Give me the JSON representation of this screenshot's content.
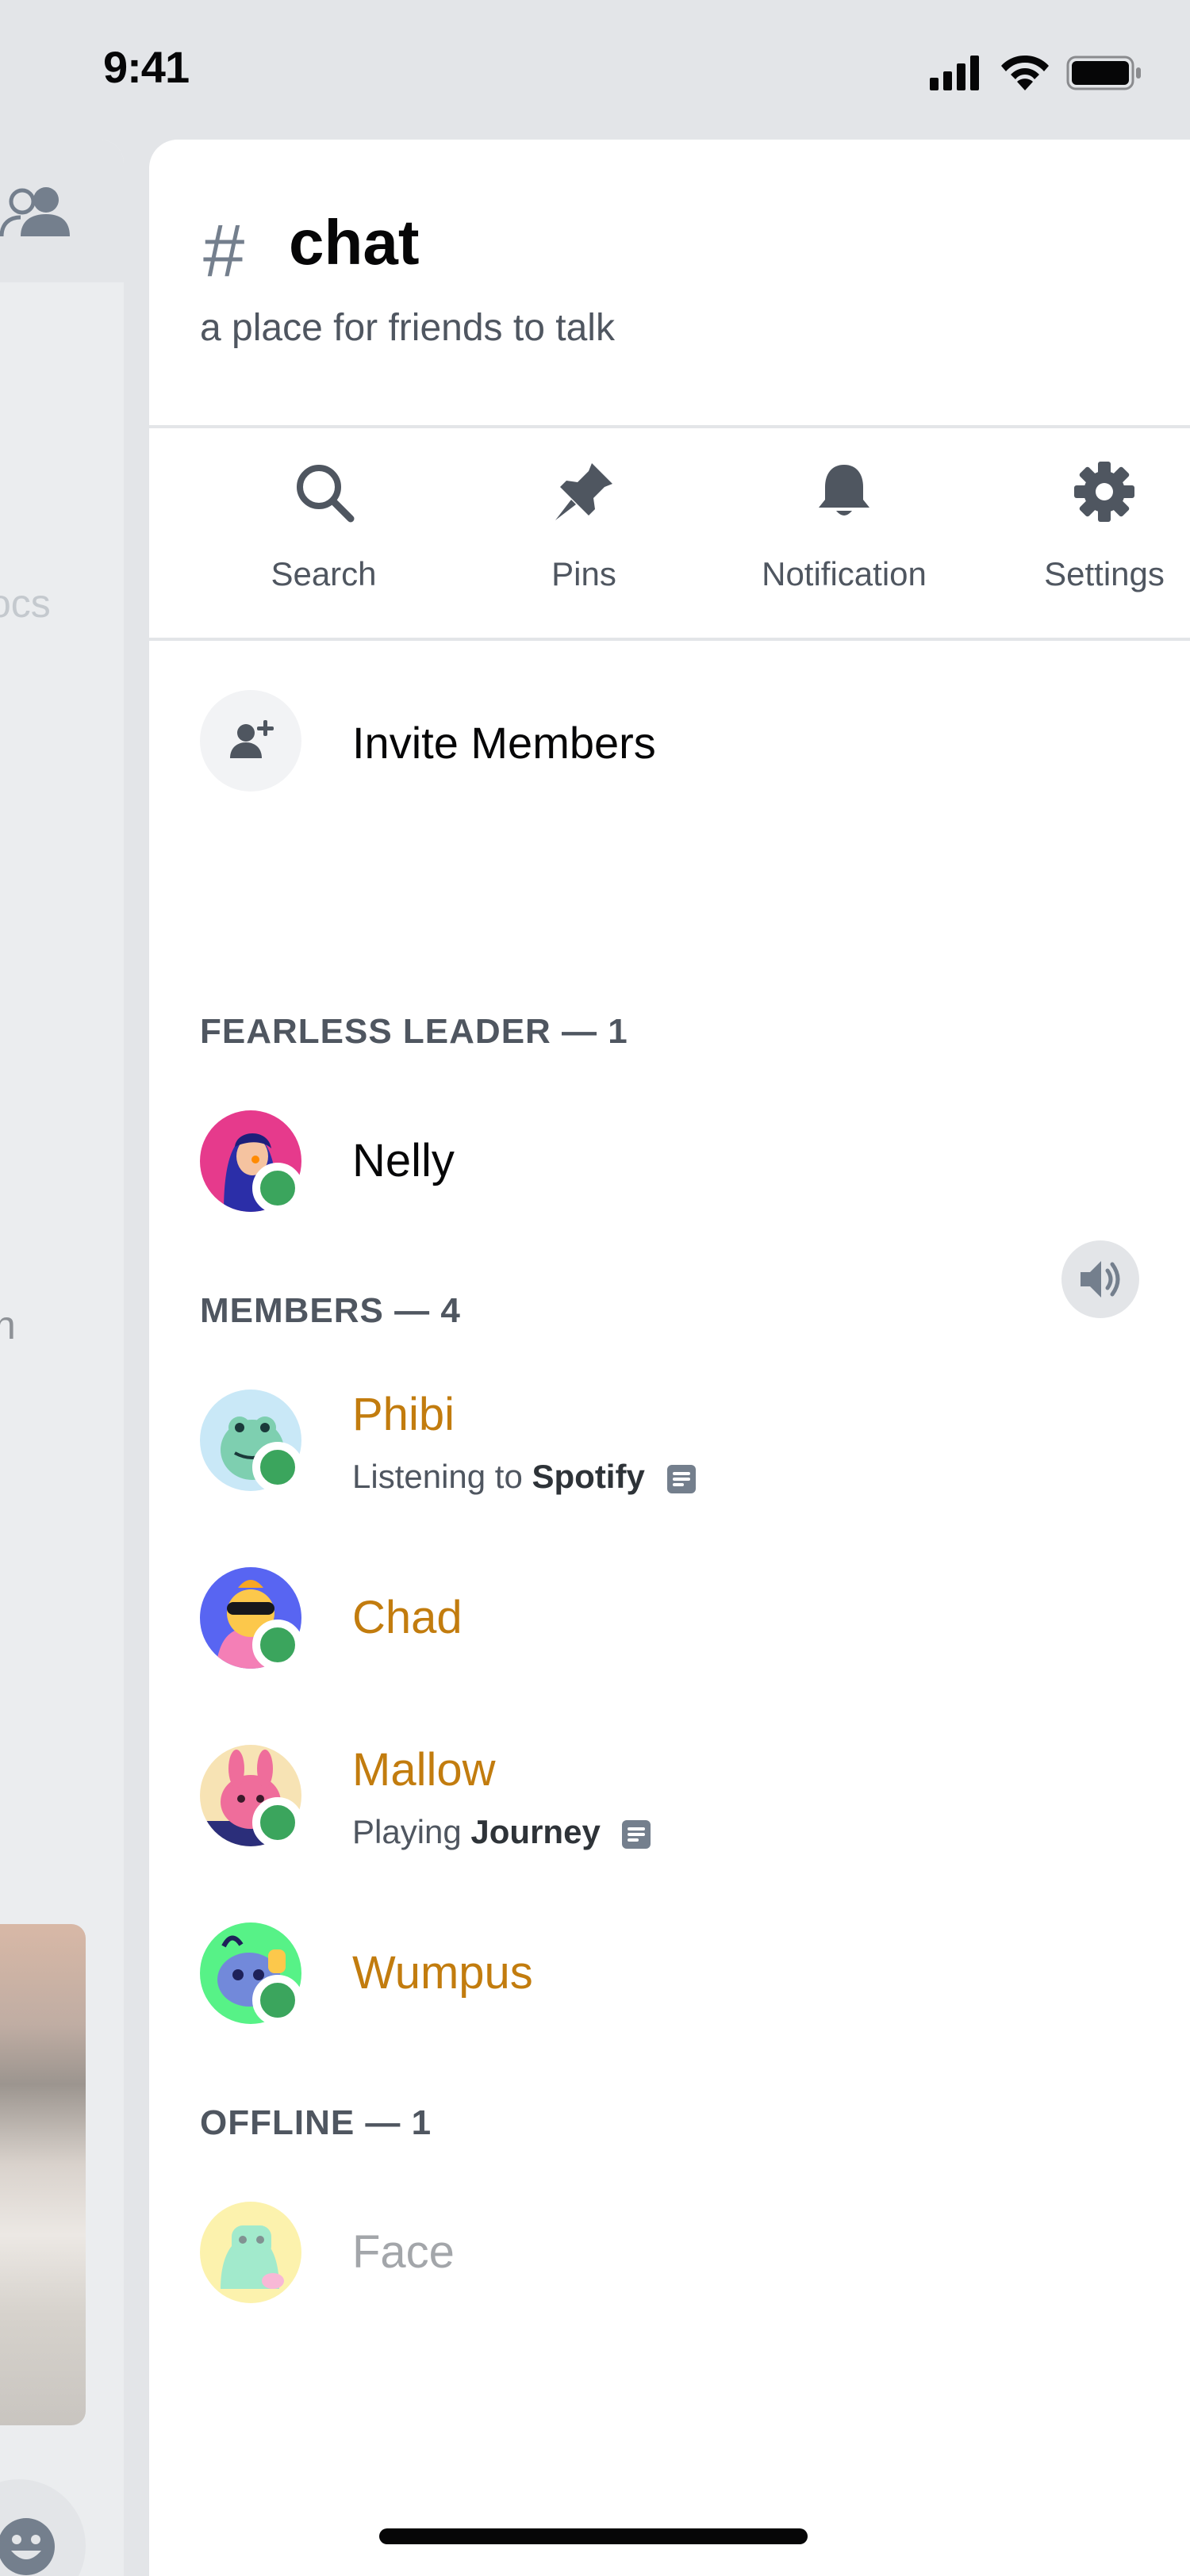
{
  "status_bar": {
    "time": "9:41"
  },
  "left_panel": {
    "text_docs": "ocs",
    "text_n": "n"
  },
  "channel": {
    "hash": "#",
    "name": "chat",
    "topic": "a place for friends to talk"
  },
  "actions": [
    {
      "label": "Search",
      "icon": "search-icon"
    },
    {
      "label": "Pins",
      "icon": "pin-icon"
    },
    {
      "label": "Notification",
      "icon": "bell-icon"
    },
    {
      "label": "Settings",
      "icon": "gear-icon"
    }
  ],
  "invite": {
    "label": "Invite Members",
    "icon": "add-user-icon"
  },
  "sections": {
    "leader": "FEARLESS LEADER — 1",
    "members": "MEMBERS — 4",
    "offline": "OFFLINE — 1"
  },
  "leader": {
    "name": "Nelly",
    "status": "online"
  },
  "members": [
    {
      "name": "Phibi",
      "activity_prefix": "Listening to ",
      "activity_bold": "Spotify",
      "status": "online"
    },
    {
      "name": "Chad",
      "status": "online"
    },
    {
      "name": "Mallow",
      "activity_prefix": "Playing ",
      "activity_bold": "Journey",
      "status": "online"
    },
    {
      "name": "Wumpus",
      "status": "online"
    }
  ],
  "offline": [
    {
      "name": "Face",
      "status": "offline"
    }
  ],
  "colors": {
    "online": "#3ba55d",
    "member_name": "#c27c0e",
    "offline_name": "#a3a6aa",
    "icon": "#4f5660"
  }
}
